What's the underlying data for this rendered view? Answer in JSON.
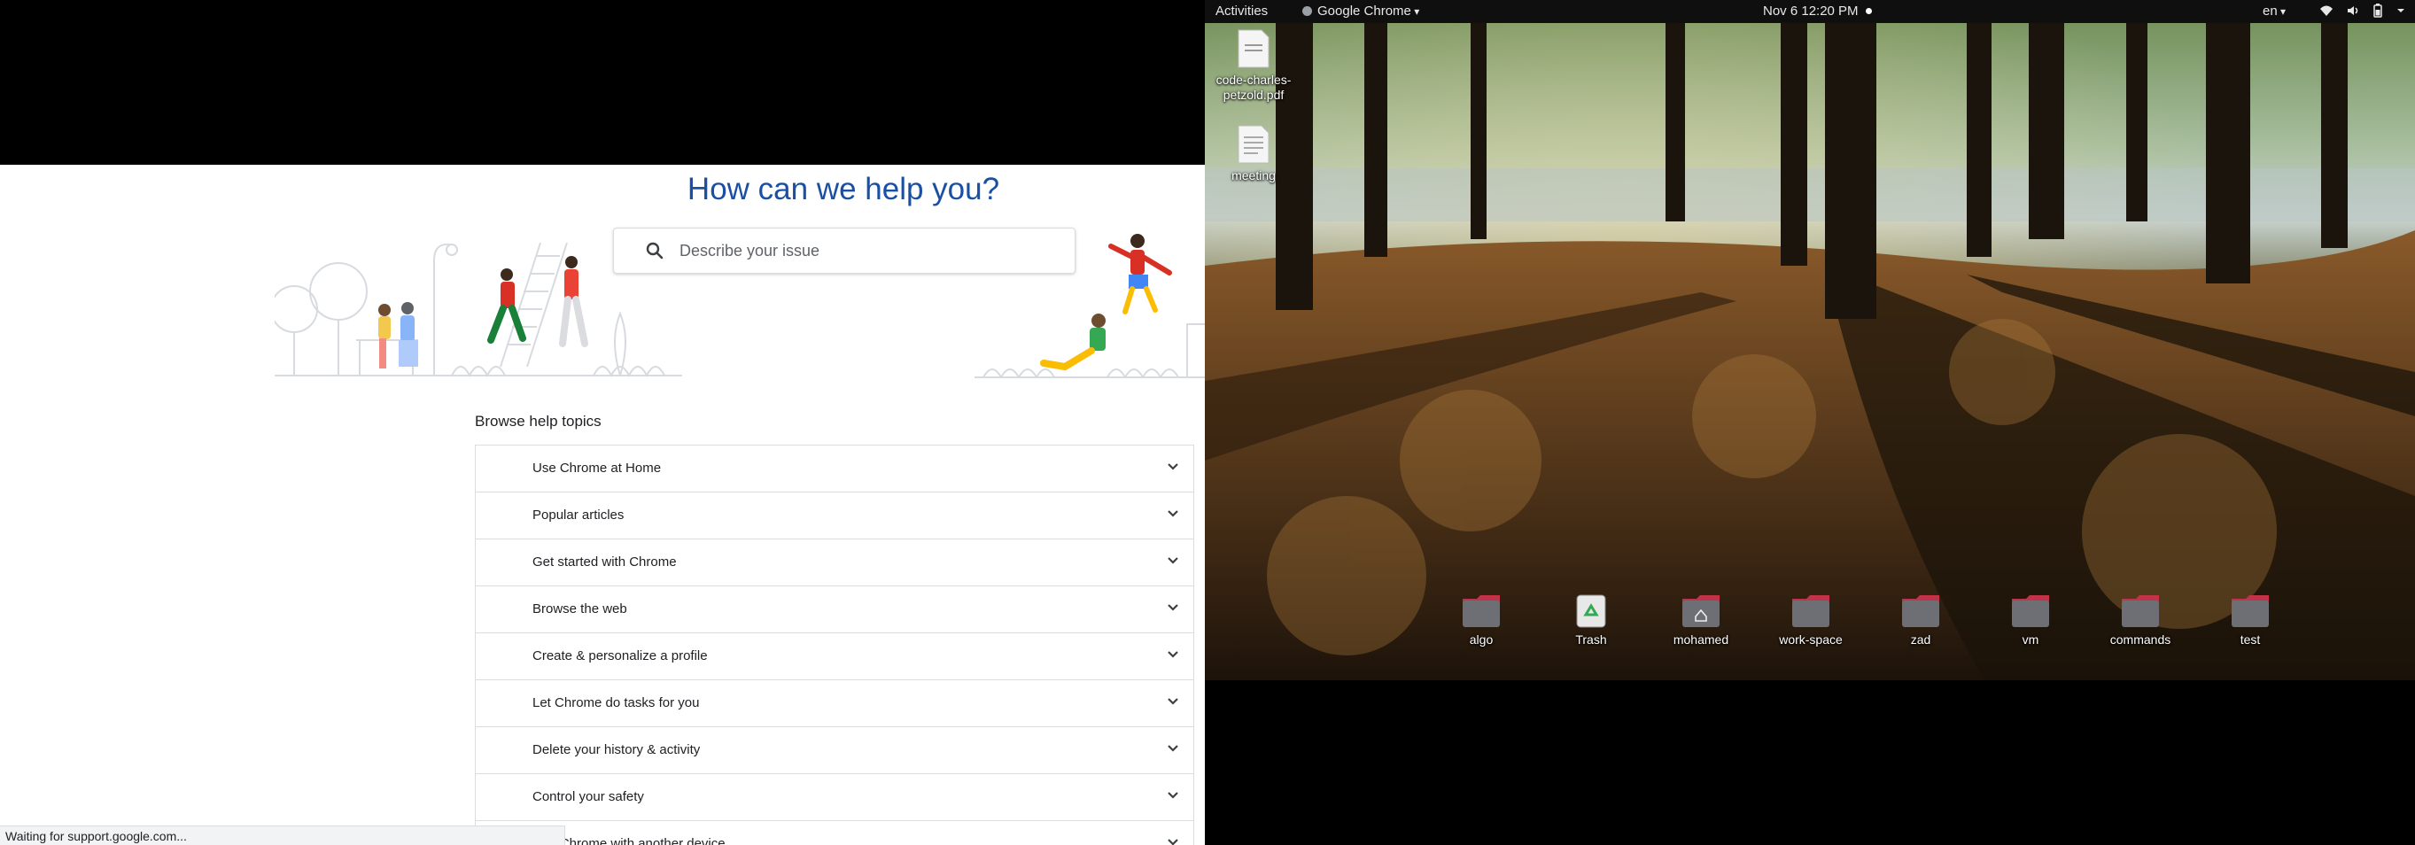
{
  "browser": {
    "status_text": "Waiting for support.google.com..."
  },
  "help": {
    "title": "How can we help you?",
    "search_placeholder": "Describe your issue",
    "browse_heading": "Browse help topics",
    "topics": [
      "Use Chrome at Home",
      "Popular articles",
      "Get started with Chrome",
      "Browse the web",
      "Create & personalize a profile",
      "Let Chrome do tasks for you",
      "Delete your history & activity",
      "Control your safety",
      "Use Chrome with another device"
    ],
    "colors": {
      "title": "#1a4fa3",
      "border": "#dadce0"
    }
  },
  "desktop": {
    "topbar": {
      "activities": "Activities",
      "app_name": "Google Chrome",
      "clock": "Nov 6  12:20 PM",
      "lang": "en",
      "tray_icons": [
        "wifi-icon",
        "volume-icon",
        "battery-icon",
        "system-menu-icon"
      ]
    },
    "files": [
      {
        "name": "code-charles-petzold.pdf",
        "icon": "pdf-file-icon"
      },
      {
        "name": "meeting",
        "icon": "text-file-icon"
      }
    ],
    "dock_items": [
      {
        "name": "algo",
        "icon": "folder-icon"
      },
      {
        "name": "Trash",
        "icon": "trash-icon"
      },
      {
        "name": "mohamed",
        "icon": "home-folder-icon"
      },
      {
        "name": "work-space",
        "icon": "folder-icon"
      },
      {
        "name": "zad",
        "icon": "folder-icon"
      },
      {
        "name": "vm",
        "icon": "folder-icon"
      },
      {
        "name": "commands",
        "icon": "folder-icon"
      },
      {
        "name": "test",
        "icon": "folder-icon"
      }
    ],
    "colors": {
      "folder": "#6d6f74",
      "folder_tab": "#c2334a",
      "topbar": "#0f0f0f"
    }
  }
}
